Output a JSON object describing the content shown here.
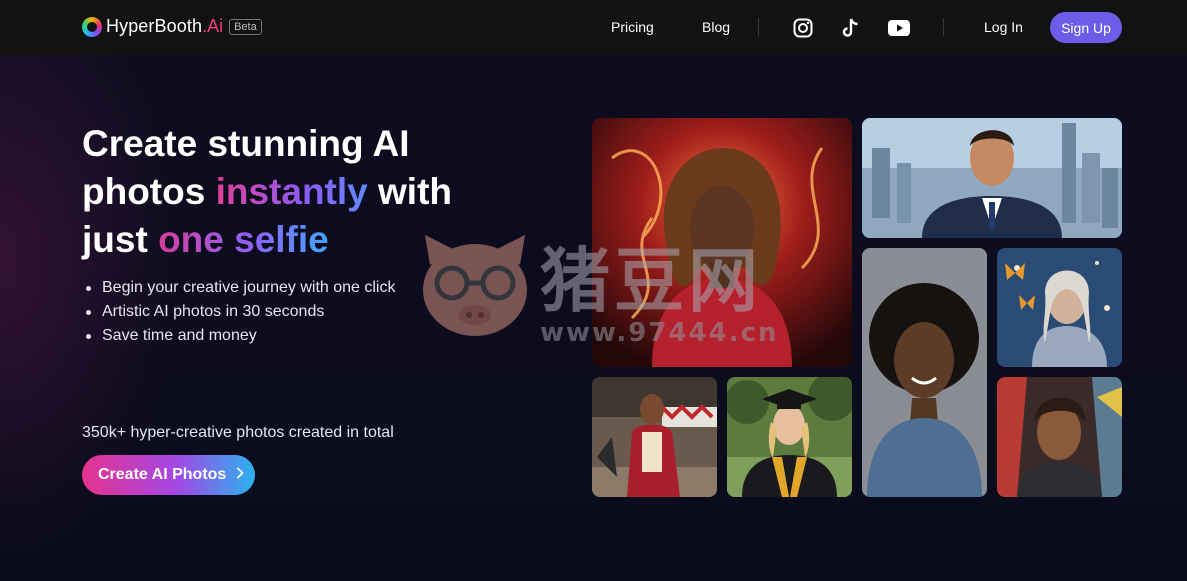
{
  "brand": {
    "name": "HyperBooth",
    "suffix": ".Ai",
    "badge": "Beta"
  },
  "nav": {
    "links": [
      {
        "label": "Pricing"
      },
      {
        "label": "Blog"
      }
    ],
    "social_icons": [
      "instagram-icon",
      "tiktok-icon",
      "youtube-icon"
    ],
    "login_label": "Log In",
    "signup_label": "Sign Up"
  },
  "hero": {
    "headline_line1": "Create stunning AI",
    "headline_line2_a": "photos ",
    "headline_line2_b": "instantly",
    "headline_line2_c": " with",
    "headline_line3_a": "just ",
    "headline_line3_b": "one selfie",
    "bullets": [
      "Begin your creative journey with one click",
      "Artistic AI photos in 30 seconds",
      "Save time and money"
    ],
    "stat": "350k+ hyper-creative photos created in total",
    "cta_label": "Create AI Photos"
  },
  "gallery": [
    {
      "subject": "woman with fiery hair portrait"
    },
    {
      "subject": "man in suit with city skyline"
    },
    {
      "subject": "woman with afro portrait"
    },
    {
      "subject": "older woman with butterflies"
    },
    {
      "subject": "ringmaster at circus"
    },
    {
      "subject": "graduate in cap and gown"
    },
    {
      "subject": "man with colorful backdrop"
    }
  ],
  "watermark": {
    "text": "猪豆网",
    "url": "www.97444.cn"
  },
  "colors": {
    "accent": "#6c5ce7",
    "brand_pink": "#ea3f7e",
    "nav_bg": "#121212",
    "page_bg": "#0b0c1c"
  }
}
